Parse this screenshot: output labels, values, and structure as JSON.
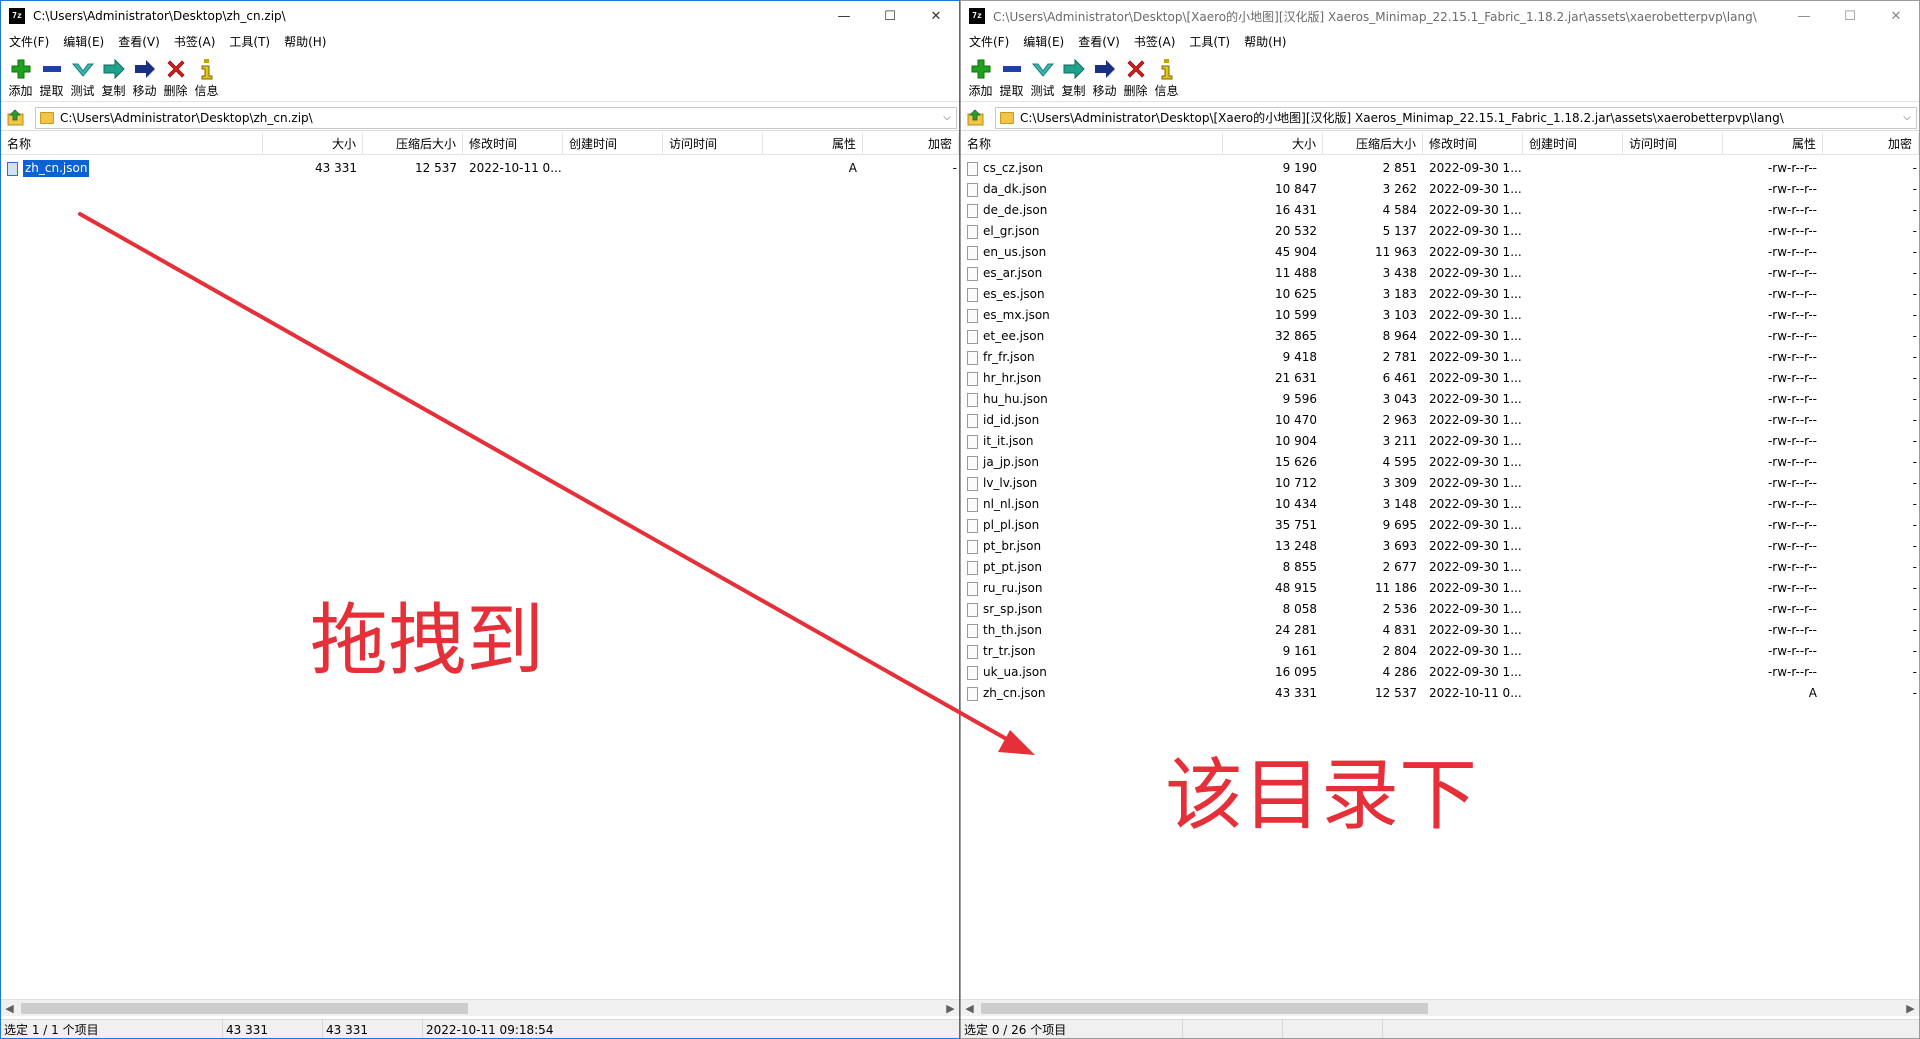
{
  "left": {
    "title": "C:\\Users\\Administrator\\Desktop\\zh_cn.zip\\",
    "menu": [
      "文件(F)",
      "编辑(E)",
      "查看(V)",
      "书签(A)",
      "工具(T)",
      "帮助(H)"
    ],
    "toolbar": [
      "添加",
      "提取",
      "测试",
      "复制",
      "移动",
      "删除",
      "信息"
    ],
    "address": "C:\\Users\\Administrator\\Desktop\\zh_cn.zip\\",
    "columns": [
      "名称",
      "大小",
      "压缩后大小",
      "修改时间",
      "创建时间",
      "访问时间",
      "属性",
      "加密"
    ],
    "files": [
      {
        "name": "zh_cn.json",
        "size": "43 331",
        "packed": "12 537",
        "modified": "2022-10-11 0...",
        "attr": "A",
        "enc": "-"
      }
    ],
    "status": [
      "选定 1 / 1 个项目",
      "43 331",
      "43 331",
      "2022-10-11 09:18:54"
    ]
  },
  "right": {
    "title": "C:\\Users\\Administrator\\Desktop\\[Xaero的小地图][汉化版] Xaeros_Minimap_22.15.1_Fabric_1.18.2.jar\\assets\\xaerobetterpvp\\lang\\",
    "menu": [
      "文件(F)",
      "编辑(E)",
      "查看(V)",
      "书签(A)",
      "工具(T)",
      "帮助(H)"
    ],
    "toolbar": [
      "添加",
      "提取",
      "测试",
      "复制",
      "移动",
      "删除",
      "信息"
    ],
    "address": "C:\\Users\\Administrator\\Desktop\\[Xaero的小地图][汉化版] Xaeros_Minimap_22.15.1_Fabric_1.18.2.jar\\assets\\xaerobetterpvp\\lang\\",
    "columns": [
      "名称",
      "大小",
      "压缩后大小",
      "修改时间",
      "创建时间",
      "访问时间",
      "属性",
      "加密"
    ],
    "files": [
      {
        "name": "cs_cz.json",
        "size": "9 190",
        "packed": "2 851",
        "modified": "2022-09-30 1...",
        "attr": "-rw-r--r--",
        "enc": "-"
      },
      {
        "name": "da_dk.json",
        "size": "10 847",
        "packed": "3 262",
        "modified": "2022-09-30 1...",
        "attr": "-rw-r--r--",
        "enc": "-"
      },
      {
        "name": "de_de.json",
        "size": "16 431",
        "packed": "4 584",
        "modified": "2022-09-30 1...",
        "attr": "-rw-r--r--",
        "enc": "-"
      },
      {
        "name": "el_gr.json",
        "size": "20 532",
        "packed": "5 137",
        "modified": "2022-09-30 1...",
        "attr": "-rw-r--r--",
        "enc": "-"
      },
      {
        "name": "en_us.json",
        "size": "45 904",
        "packed": "11 963",
        "modified": "2022-09-30 1...",
        "attr": "-rw-r--r--",
        "enc": "-"
      },
      {
        "name": "es_ar.json",
        "size": "11 488",
        "packed": "3 438",
        "modified": "2022-09-30 1...",
        "attr": "-rw-r--r--",
        "enc": "-"
      },
      {
        "name": "es_es.json",
        "size": "10 625",
        "packed": "3 183",
        "modified": "2022-09-30 1...",
        "attr": "-rw-r--r--",
        "enc": "-"
      },
      {
        "name": "es_mx.json",
        "size": "10 599",
        "packed": "3 103",
        "modified": "2022-09-30 1...",
        "attr": "-rw-r--r--",
        "enc": "-"
      },
      {
        "name": "et_ee.json",
        "size": "32 865",
        "packed": "8 964",
        "modified": "2022-09-30 1...",
        "attr": "-rw-r--r--",
        "enc": "-"
      },
      {
        "name": "fr_fr.json",
        "size": "9 418",
        "packed": "2 781",
        "modified": "2022-09-30 1...",
        "attr": "-rw-r--r--",
        "enc": "-"
      },
      {
        "name": "hr_hr.json",
        "size": "21 631",
        "packed": "6 461",
        "modified": "2022-09-30 1...",
        "attr": "-rw-r--r--",
        "enc": "-"
      },
      {
        "name": "hu_hu.json",
        "size": "9 596",
        "packed": "3 043",
        "modified": "2022-09-30 1...",
        "attr": "-rw-r--r--",
        "enc": "-"
      },
      {
        "name": "id_id.json",
        "size": "10 470",
        "packed": "2 963",
        "modified": "2022-09-30 1...",
        "attr": "-rw-r--r--",
        "enc": "-"
      },
      {
        "name": "it_it.json",
        "size": "10 904",
        "packed": "3 211",
        "modified": "2022-09-30 1...",
        "attr": "-rw-r--r--",
        "enc": "-"
      },
      {
        "name": "ja_jp.json",
        "size": "15 626",
        "packed": "4 595",
        "modified": "2022-09-30 1...",
        "attr": "-rw-r--r--",
        "enc": "-"
      },
      {
        "name": "lv_lv.json",
        "size": "10 712",
        "packed": "3 309",
        "modified": "2022-09-30 1...",
        "attr": "-rw-r--r--",
        "enc": "-"
      },
      {
        "name": "nl_nl.json",
        "size": "10 434",
        "packed": "3 148",
        "modified": "2022-09-30 1...",
        "attr": "-rw-r--r--",
        "enc": "-"
      },
      {
        "name": "pl_pl.json",
        "size": "35 751",
        "packed": "9 695",
        "modified": "2022-09-30 1...",
        "attr": "-rw-r--r--",
        "enc": "-"
      },
      {
        "name": "pt_br.json",
        "size": "13 248",
        "packed": "3 693",
        "modified": "2022-09-30 1...",
        "attr": "-rw-r--r--",
        "enc": "-"
      },
      {
        "name": "pt_pt.json",
        "size": "8 855",
        "packed": "2 677",
        "modified": "2022-09-30 1...",
        "attr": "-rw-r--r--",
        "enc": "-"
      },
      {
        "name": "ru_ru.json",
        "size": "48 915",
        "packed": "11 186",
        "modified": "2022-09-30 1...",
        "attr": "-rw-r--r--",
        "enc": "-"
      },
      {
        "name": "sr_sp.json",
        "size": "8 058",
        "packed": "2 536",
        "modified": "2022-09-30 1...",
        "attr": "-rw-r--r--",
        "enc": "-"
      },
      {
        "name": "th_th.json",
        "size": "24 281",
        "packed": "4 831",
        "modified": "2022-09-30 1...",
        "attr": "-rw-r--r--",
        "enc": "-"
      },
      {
        "name": "tr_tr.json",
        "size": "9 161",
        "packed": "2 804",
        "modified": "2022-09-30 1...",
        "attr": "-rw-r--r--",
        "enc": "-"
      },
      {
        "name": "uk_ua.json",
        "size": "16 095",
        "packed": "4 286",
        "modified": "2022-09-30 1...",
        "attr": "-rw-r--r--",
        "enc": "-"
      },
      {
        "name": "zh_cn.json",
        "size": "43 331",
        "packed": "12 537",
        "modified": "2022-10-11 0...",
        "attr": "A",
        "enc": "-"
      }
    ],
    "status": [
      "选定 0 / 26 个项目"
    ]
  },
  "annotations": {
    "drag_text": "拖拽到",
    "target_text": "该目录下",
    "arrow_color": "#e5303a"
  },
  "window_buttons": [
    "minimize",
    "maximize",
    "close"
  ],
  "app_icon_text": "7z"
}
